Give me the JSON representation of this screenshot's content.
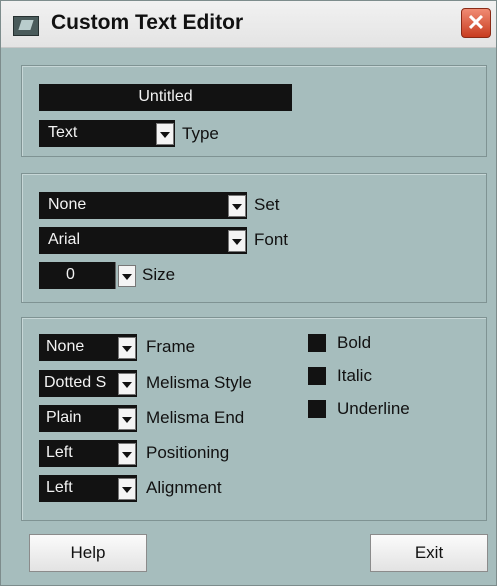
{
  "window": {
    "title": "Custom Text Editor",
    "close_glyph": "✕"
  },
  "name_panel": {
    "name_value": "Untitled",
    "type_value": "Text",
    "type_label": "Type"
  },
  "font_panel": {
    "set_value": "None",
    "set_label": "Set",
    "font_value": "Arial",
    "font_label": "Font",
    "size_value": "0",
    "size_label": "Size"
  },
  "style_panel": {
    "frame_value": "None",
    "frame_label": "Frame",
    "melisma_style_value": "Dotted S",
    "melisma_style_label": "Melisma Style",
    "melisma_end_value": "Plain",
    "melisma_end_label": "Melisma End",
    "positioning_value": "Left",
    "positioning_label": "Positioning",
    "alignment_value": "Left",
    "alignment_label": "Alignment",
    "bold_label": "Bold",
    "italic_label": "Italic",
    "underline_label": "Underline"
  },
  "buttons": {
    "help_label": "Help",
    "exit_label": "Exit"
  },
  "colors": {
    "window_bg": "#a6bdbd",
    "field_bg": "#121212",
    "close_red": "#c83c1f"
  },
  "icons": {
    "app": "editor-app-icon",
    "dropdown": "chevron-down-icon",
    "close": "close-icon"
  }
}
